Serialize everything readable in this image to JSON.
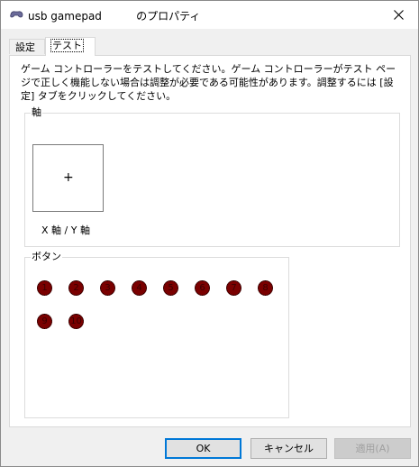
{
  "window": {
    "title": "usb gamepad          のプロパティ",
    "close_icon": "close-icon",
    "app_icon": "gamepad-icon"
  },
  "tabs": [
    {
      "label": "設定",
      "selected": false
    },
    {
      "label": "テスト",
      "selected": true
    }
  ],
  "description": "ゲーム コントローラーをテストしてください。ゲーム コントローラーがテスト ページで正しく機能しない場合は調整が必要である可能性があります。調整するには [設定] タブをクリックしてください。",
  "axes_group": {
    "label": "軸",
    "crosshair": "+",
    "axis_label": "X 軸 / Y 軸"
  },
  "buttons_group": {
    "label": "ボタン",
    "buttons": [
      "1",
      "2",
      "3",
      "4",
      "5",
      "6",
      "7",
      "8",
      "9",
      "10"
    ],
    "dot_color": "#7a0000"
  },
  "footer": {
    "ok": "OK",
    "cancel": "キャンセル",
    "apply": "適用(A)"
  },
  "colors": {
    "accent": "#0078d7"
  }
}
